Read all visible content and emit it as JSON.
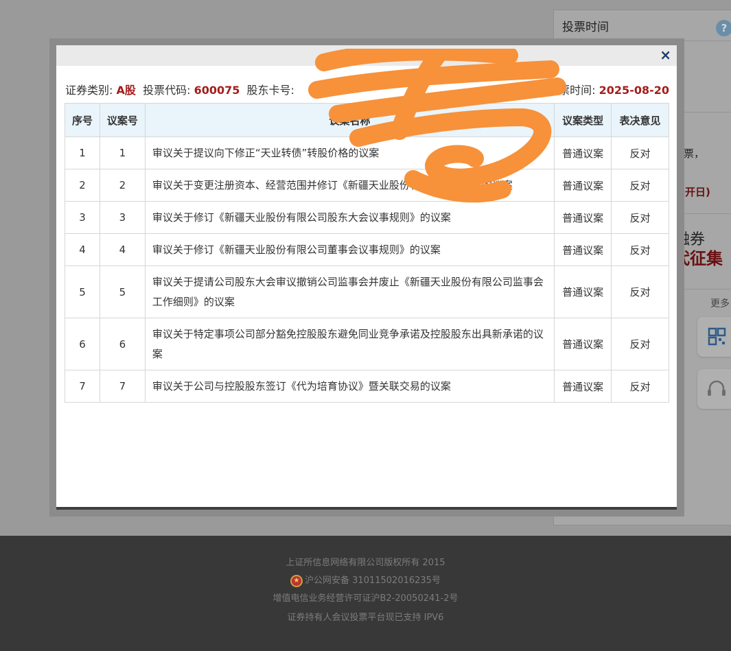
{
  "background_panel": {
    "title": "投票时间",
    "help": "?",
    "fragment_1": "投票，",
    "fragment_2": "召开日)",
    "fragment_3": "融券",
    "fragment_4": "代征集",
    "more": "更多"
  },
  "modal": {
    "close_label": "×",
    "info": {
      "security_type_label": "证券类别:",
      "security_type_value": "A股",
      "code_label": "投票代码:",
      "code_value": "600075",
      "record_label": "股东卡号:",
      "vote_time_label": "投票时间:",
      "vote_time_value": "2025-08-20"
    },
    "table": {
      "columns": [
        "序号",
        "议案号",
        "议案名称",
        "议案类型",
        "表决意见"
      ],
      "rows": [
        {
          "seq": "1",
          "no": "1",
          "title": "审议关于提议向下修正“天业转债”转股价格的议案",
          "type": "普通议案",
          "opinion": "反对"
        },
        {
          "seq": "2",
          "no": "2",
          "title": "审议关于变更注册资本、经营范围并修订《新疆天业股份有限公司章程》的议案",
          "type": "普通议案",
          "opinion": "反对"
        },
        {
          "seq": "3",
          "no": "3",
          "title": "审议关于修订《新疆天业股份有限公司股东大会议事规则》的议案",
          "type": "普通议案",
          "opinion": "反对"
        },
        {
          "seq": "4",
          "no": "4",
          "title": "审议关于修订《新疆天业股份有限公司董事会议事规则》的议案",
          "type": "普通议案",
          "opinion": "反对"
        },
        {
          "seq": "5",
          "no": "5",
          "title": "审议关于提请公司股东大会审议撤销公司监事会并废止《新疆天业股份有限公司监事会工作细则》的议案",
          "type": "普通议案",
          "opinion": "反对"
        },
        {
          "seq": "6",
          "no": "6",
          "title": "审议关于特定事项公司部分豁免控股股东避免同业竞争承诺及控股股东出具新承诺的议案",
          "type": "普通议案",
          "opinion": "反对"
        },
        {
          "seq": "7",
          "no": "7",
          "title": "审议关于公司与控股股东签订《代为培育协议》暨关联交易的议案",
          "type": "普通议案",
          "opinion": "反对"
        }
      ]
    }
  },
  "footer": {
    "copyright": "上证所信息网络有限公司版权所有 2015",
    "police_record": "沪公网安备 31011502016235号",
    "license": "增值电信业务经营许可证沪B2-20050241-2号",
    "ipv6": "证券持有人会议投票平台现已支持 IPV6"
  },
  "colors": {
    "accent_red": "#a51c1c",
    "header_blue": "#e9f4fb",
    "scribble_orange": "#f7913a"
  }
}
